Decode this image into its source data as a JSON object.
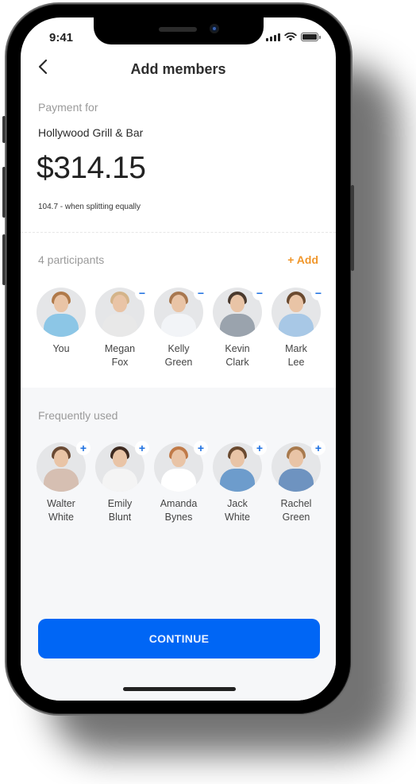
{
  "status_bar": {
    "time": "9:41",
    "icons": [
      "signal-icon",
      "wifi-icon",
      "battery-icon"
    ]
  },
  "header": {
    "back_icon": "chevron-left-icon",
    "title": "Add members"
  },
  "payment": {
    "label": "Payment for",
    "merchant": "Hollywood Grill & Bar",
    "amount": "$314.15",
    "split_note": "104.7 - when splitting equally"
  },
  "participants": {
    "label": "4 participants",
    "add_label": "+ Add",
    "people": [
      {
        "first": "You",
        "last": "",
        "badge": "",
        "hair": "#b07a4a",
        "shirt": "#8cc6e6"
      },
      {
        "first": "Megan",
        "last": "Fox",
        "badge": "−",
        "hair": "#d4b48a",
        "shirt": "#e8e8e8"
      },
      {
        "first": "Kelly",
        "last": "Green",
        "badge": "−",
        "hair": "#a87850",
        "shirt": "#f2f4f7"
      },
      {
        "first": "Kevin",
        "last": "Clark",
        "badge": "−",
        "hair": "#4a3a2e",
        "shirt": "#9aa3ad"
      },
      {
        "first": "Mark",
        "last": "Lee",
        "badge": "−",
        "hair": "#6a4a30",
        "shirt": "#a8c8e6"
      }
    ]
  },
  "frequent": {
    "label": "Frequently used",
    "people": [
      {
        "first": "Walter",
        "last": "White",
        "badge": "+",
        "hair": "#6a4a34",
        "shirt": "#d6bfb2"
      },
      {
        "first": "Emily",
        "last": "Blunt",
        "badge": "+",
        "hair": "#3e2a20",
        "shirt": "#f4f4f4"
      },
      {
        "first": "Amanda",
        "last": "Bynes",
        "badge": "+",
        "hair": "#c07a48",
        "shirt": "#ffffff"
      },
      {
        "first": "Jack",
        "last": "White",
        "badge": "+",
        "hair": "#6a4a30",
        "shirt": "#6d9ccc"
      },
      {
        "first": "Rachel",
        "last": "Green",
        "badge": "+",
        "hair": "#a87a4e",
        "shirt": "#6e93c0"
      }
    ]
  },
  "actions": {
    "continue_label": "CONTINUE"
  },
  "colors": {
    "accent_blue": "#0066f5",
    "accent_orange": "#f0962a",
    "badge_blue": "#1c6fe0",
    "section_gray": "#f6f7f9"
  }
}
